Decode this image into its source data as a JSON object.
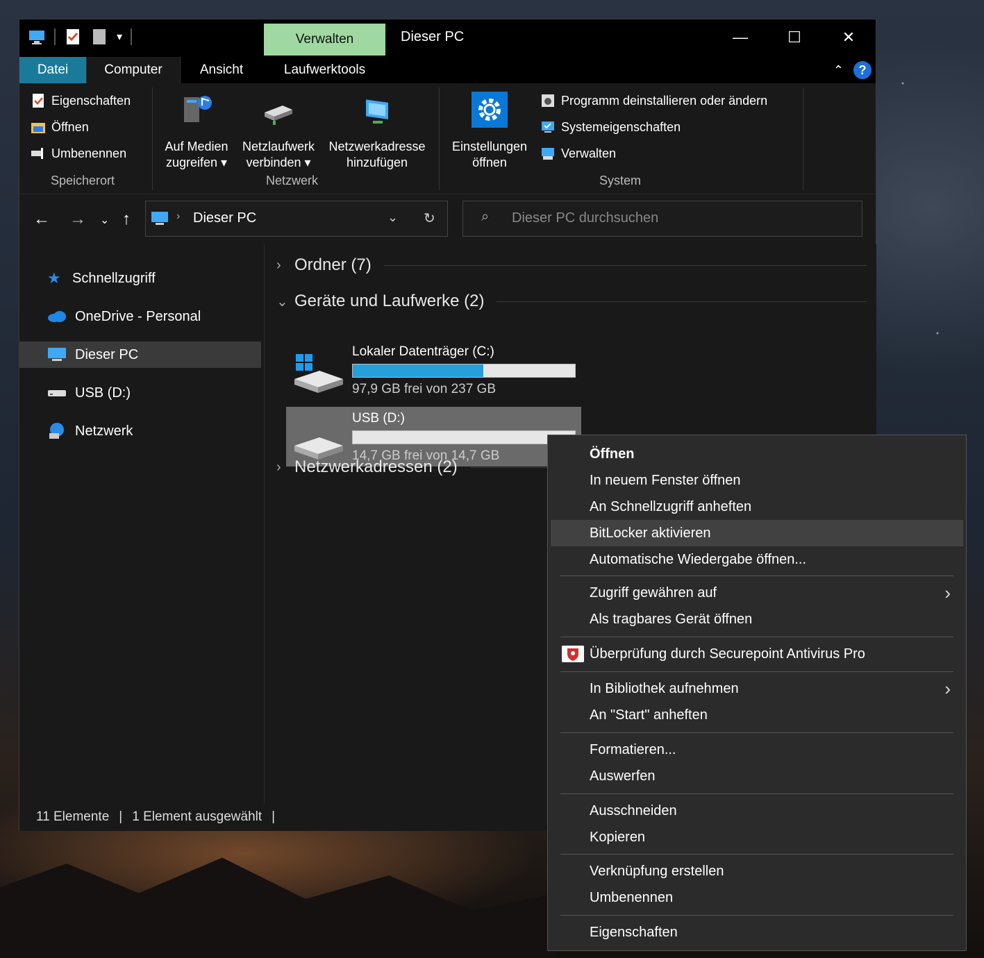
{
  "window": {
    "title": "Dieser PC",
    "context_tab": "Verwalten",
    "controls": {
      "minimize": "—",
      "maximize": "☐",
      "close": "✕"
    }
  },
  "tabs": [
    "Datei",
    "Computer",
    "Ansicht",
    "Laufwerktools"
  ],
  "ribbon": {
    "location": {
      "label": "Speicherort",
      "items": [
        "Eigenschaften",
        "Öffnen",
        "Umbenennen"
      ]
    },
    "network": {
      "label": "Netzwerk",
      "media": [
        "Auf Medien",
        "zugreifen ▾"
      ],
      "map_drive": [
        "Netzlaufwerk",
        "verbinden ▾"
      ],
      "add_location": [
        "Netzwerkadresse",
        "hinzufügen"
      ]
    },
    "system": {
      "label": "System",
      "settings": [
        "Einstellungen",
        "öffnen"
      ],
      "items": [
        "Programm deinstallieren oder ändern",
        "Systemeigenschaften",
        "Verwalten"
      ]
    }
  },
  "address": {
    "path": "Dieser PC",
    "search_placeholder": "Dieser PC durchsuchen"
  },
  "sidebar": [
    {
      "label": "Schnellzugriff",
      "icon": "star-icon"
    },
    {
      "label": "OneDrive - Personal",
      "icon": "cloud-icon"
    },
    {
      "label": "Dieser PC",
      "icon": "pc-icon",
      "selected": true
    },
    {
      "label": "USB (D:)",
      "icon": "usb-drive-icon"
    },
    {
      "label": "Netzwerk",
      "icon": "network-icon"
    }
  ],
  "groups": {
    "folders": "Ordner (7)",
    "devices": "Geräte und Laufwerke (2)",
    "network": "Netzwerkadressen (2)"
  },
  "drives": [
    {
      "name": "Lokaler Datenträger (C:)",
      "free": "97,9 GB frei von 237 GB",
      "used_fraction": 0.587,
      "bar_color": "#26a0da"
    },
    {
      "name": "USB (D:)",
      "free": "14,7 GB frei von 14,7 GB",
      "used_fraction": 0.0,
      "selected": true
    }
  ],
  "status": {
    "count": "11 Elemente",
    "selected": "1 Element ausgewählt"
  },
  "context_menu": [
    "Öffnen",
    "In neuem Fenster öffnen",
    "An Schnellzugriff anheften",
    "BitLocker aktivieren",
    "Automatische Wiedergabe öffnen...",
    "Zugriff gewähren auf",
    "Als tragbares Gerät öffnen",
    "Überprüfung durch Securepoint Antivirus Pro",
    "In Bibliothek aufnehmen",
    "An \"Start\" anheften",
    "Formatieren...",
    "Auswerfen",
    "Ausschneiden",
    "Kopieren",
    "Verknüpfung erstellen",
    "Umbenennen",
    "Eigenschaften"
  ],
  "colors": {
    "accent_file_tab": "#1a7a9a",
    "manage_tab": "#9fd9a1",
    "drive_bar": "#26a0da"
  }
}
